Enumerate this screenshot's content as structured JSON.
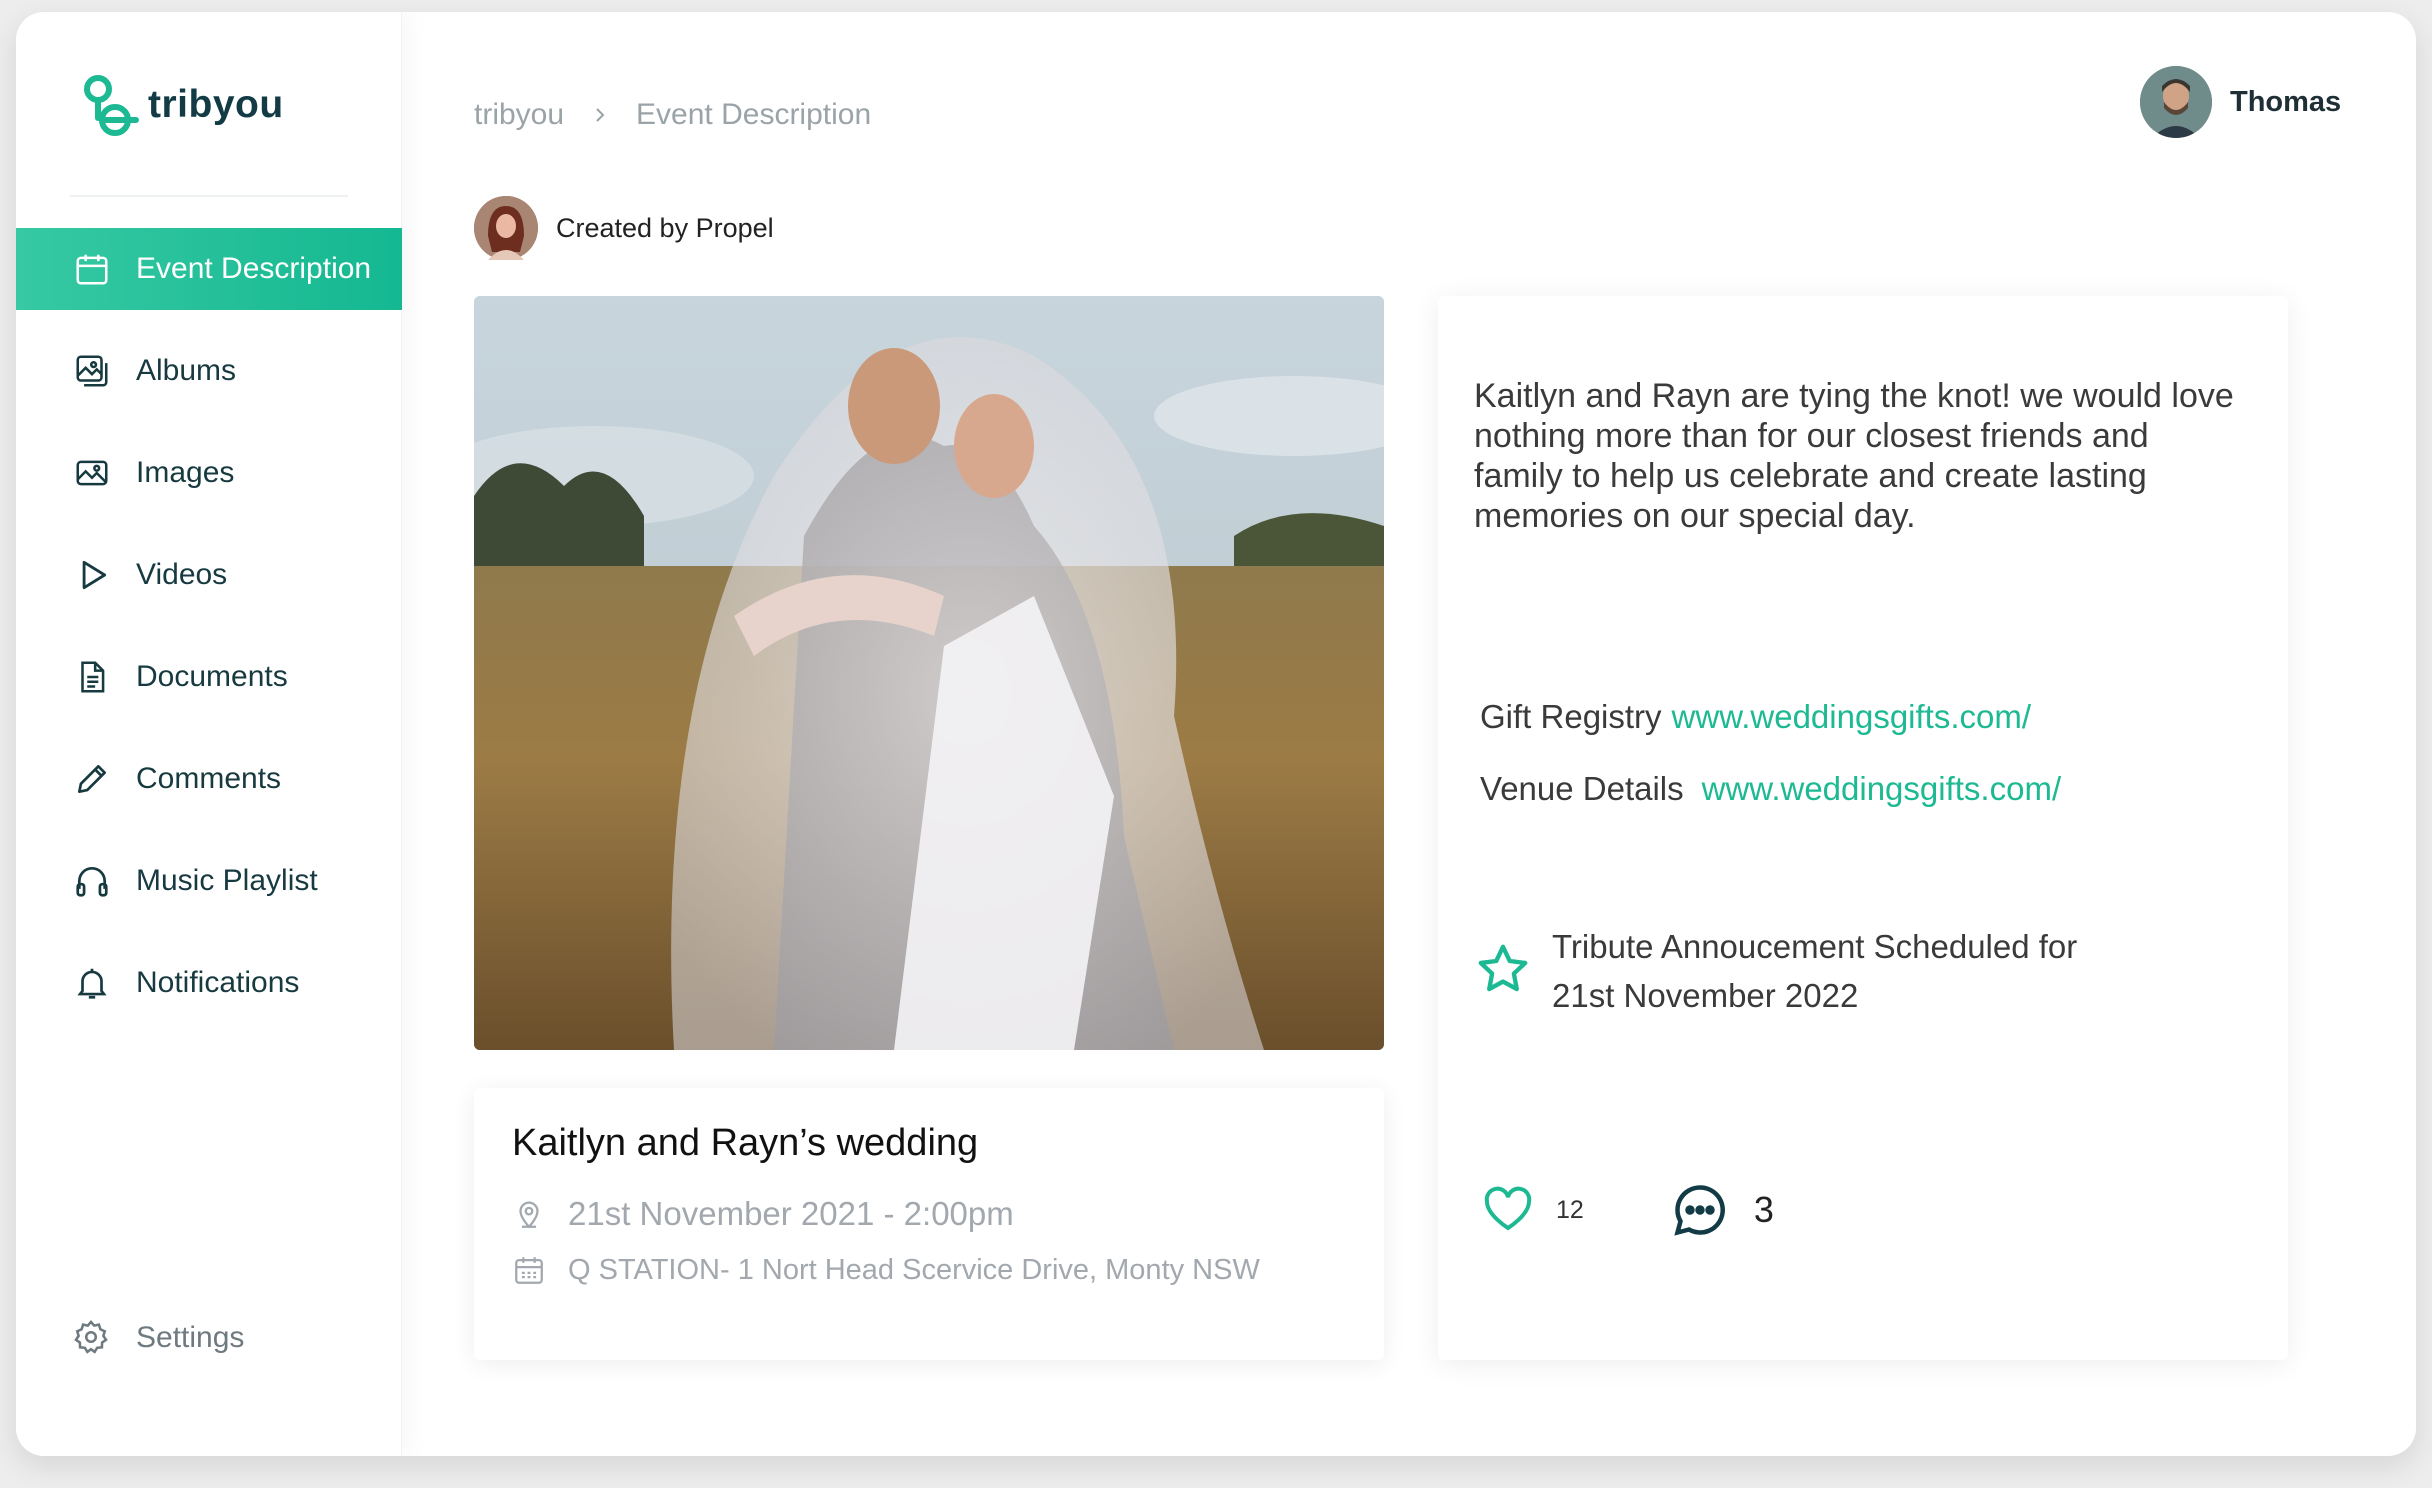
{
  "app": {
    "brand": "tribyou"
  },
  "sidebar": {
    "items": [
      {
        "label": "Event Description",
        "icon": "calendar-icon",
        "active": true
      },
      {
        "label": "Albums",
        "icon": "albums-icon"
      },
      {
        "label": "Images",
        "icon": "image-icon"
      },
      {
        "label": "Videos",
        "icon": "play-icon"
      },
      {
        "label": "Documents",
        "icon": "document-icon"
      },
      {
        "label": "Comments",
        "icon": "pencil-icon"
      },
      {
        "label": "Music Playlist",
        "icon": "headphones-icon"
      },
      {
        "label": "Notifications",
        "icon": "bell-icon"
      }
    ],
    "settings_label": "Settings"
  },
  "header": {
    "breadcrumb": [
      "tribyou",
      "Event Description"
    ],
    "user_name": "Thomas"
  },
  "creator": {
    "text": "Created by Propel"
  },
  "event": {
    "title": "Kaitlyn and Rayn’s wedding",
    "date": "21st November 2021 - 2:00pm",
    "location": "Q STATION- 1 Nort Head Scervice Drive, Monty NSW"
  },
  "info": {
    "description": "Kaitlyn and Rayn are tying the knot! we would love nothing more than for our closest friends and family to help us celebrate and create lasting memories on our special day.",
    "gift_registry_label": "Gift Registry",
    "gift_registry_link": "www.weddingsgifts.com/",
    "venue_label": "Venue Details",
    "venue_link": "www.weddingsgifts.com/",
    "tribute_line1": "Tribute Annoucement Scheduled for",
    "tribute_line2": "21st November 2022",
    "likes": "12",
    "comments": "3"
  },
  "colors": {
    "accent": "#1db992",
    "brand_dark": "#133b45",
    "muted": "#9aa3a8"
  }
}
